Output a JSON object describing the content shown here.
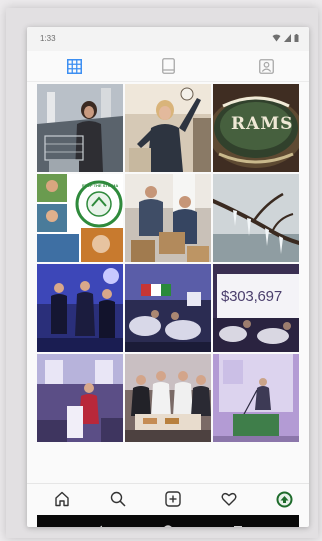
{
  "status": {
    "time": "1:33"
  },
  "tabs": [
    {
      "name": "grid-view",
      "active": true
    },
    {
      "name": "feed-view",
      "active": false
    },
    {
      "name": "tagged-view",
      "active": false
    }
  ],
  "posts": [
    {
      "caption": ""
    },
    {
      "caption": ""
    },
    {
      "caption": "RAMS"
    },
    {
      "caption": "STOP THE STIGMA"
    },
    {
      "caption": ""
    },
    {
      "caption": ""
    },
    {
      "caption": ""
    },
    {
      "caption": ""
    },
    {
      "caption": "$303,697"
    },
    {
      "caption": ""
    },
    {
      "caption": ""
    },
    {
      "caption": ""
    }
  ],
  "bottom_nav": [
    {
      "name": "home-icon"
    },
    {
      "name": "search-icon"
    },
    {
      "name": "new-post-icon"
    },
    {
      "name": "activity-icon"
    },
    {
      "name": "profile-icon"
    }
  ],
  "system_nav": [
    {
      "name": "back-icon"
    },
    {
      "name": "home-circle-icon"
    },
    {
      "name": "recents-icon"
    }
  ],
  "colors": {
    "accent": "#3d8ff2",
    "profile": "#2e7d32"
  }
}
